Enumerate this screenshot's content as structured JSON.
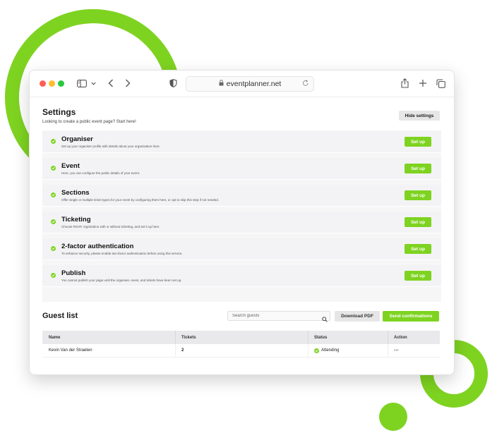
{
  "browser": {
    "url": "eventplanner.net"
  },
  "settings": {
    "title": "Settings",
    "subtitle": "Looking to create a public event page? Start here!",
    "hide_label": "Hide settings",
    "setup_label": "Set up",
    "steps": [
      {
        "name": "Organiser",
        "desc": "Set up your organiser profile with details about your organisation here.",
        "status": "complete"
      },
      {
        "name": "Event",
        "desc": "Here, you can configure the public details of your event.",
        "status": "complete"
      },
      {
        "name": "Sections",
        "desc": "Offer single or multiple ticket types for your event by configuring them here, or opt to skip this step if not needed.",
        "status": "complete"
      },
      {
        "name": "Ticketing",
        "desc": "Choose RSVP, registration with or without ticketing, and set it up here.",
        "status": "complete"
      },
      {
        "name": "2-factor authentication",
        "desc": "To enhance security, please enable two-factor authentication before using this service.",
        "status": "complete"
      },
      {
        "name": "Publish",
        "desc": "You cannot publish your page until the organiser, event, and tickets have been set up.",
        "status": "complete"
      }
    ]
  },
  "guests": {
    "title": "Guest list",
    "search_placeholder": "Search guests",
    "download_label": "Download PDF",
    "send_label": "Send confirmations",
    "columns": [
      "Name",
      "Tickets",
      "Status",
      "Action"
    ],
    "rows": [
      {
        "name": "Kevin Van der Straeten",
        "tickets": "2",
        "status": "Attending",
        "action": "···"
      }
    ]
  },
  "colors": {
    "accent": "#7ed321",
    "traffic_red": "#ff5f57",
    "traffic_yellow": "#febc2e",
    "traffic_green": "#28c840"
  }
}
